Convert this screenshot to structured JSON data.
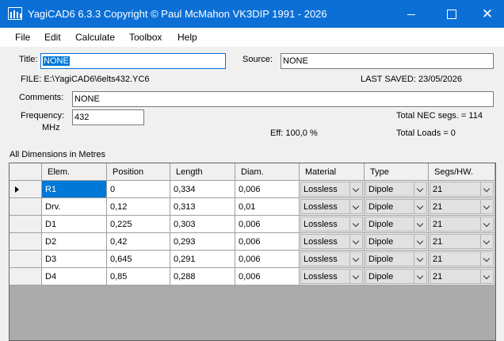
{
  "window": {
    "title": "YagiCAD6 6.3.3   Copyright © Paul McMahon VK3DIP 1991 - 2026",
    "close_glyph": "✕",
    "accent_color": "#0b6fd6"
  },
  "menu": [
    "File",
    "Edit",
    "Calculate",
    "Toolbox",
    "Help"
  ],
  "form": {
    "title_label": "Title:",
    "title_value": "NONE",
    "source_label": "Source:",
    "source_value": "NONE",
    "file_text": "FILE: E:\\YagiCAD6\\6elts432.YC6",
    "last_saved_text": "LAST SAVED: 23/05/2026",
    "comments_label": "Comments:",
    "comments_value": "NONE",
    "frequency_label": "Frequency:",
    "frequency_unit": "MHz",
    "frequency_value": "432",
    "eff_text": "Eff: 100,0 %",
    "nec_segs_text": "Total NEC segs. = 114",
    "total_loads_text": "Total Loads = 0",
    "dimensions_text": "All Dimensions in Metres"
  },
  "table": {
    "headers": [
      "Elem.",
      "Position",
      "Length",
      "Diam.",
      "Material",
      "Type",
      "Segs/HW."
    ],
    "rows": [
      {
        "elem": "R1",
        "position": "0",
        "length": "0,334",
        "diam": "0,006",
        "material": "Lossless",
        "type": "Dipole",
        "segs": "21"
      },
      {
        "elem": "Drv.",
        "position": "0,12",
        "length": "0,313",
        "diam": "0,01",
        "material": "Lossless",
        "type": "Dipole",
        "segs": "21"
      },
      {
        "elem": "D1",
        "position": "0,225",
        "length": "0,303",
        "diam": "0,006",
        "material": "Lossless",
        "type": "Dipole",
        "segs": "21"
      },
      {
        "elem": "D2",
        "position": "0,42",
        "length": "0,293",
        "diam": "0,006",
        "material": "Lossless",
        "type": "Dipole",
        "segs": "21"
      },
      {
        "elem": "D3",
        "position": "0,645",
        "length": "0,291",
        "diam": "0,006",
        "material": "Lossless",
        "type": "Dipole",
        "segs": "21"
      },
      {
        "elem": "D4",
        "position": "0,85",
        "length": "0,288",
        "diam": "0,006",
        "material": "Lossless",
        "type": "Dipole",
        "segs": "21"
      }
    ],
    "selected_row": 0,
    "selected_column": "elem"
  }
}
